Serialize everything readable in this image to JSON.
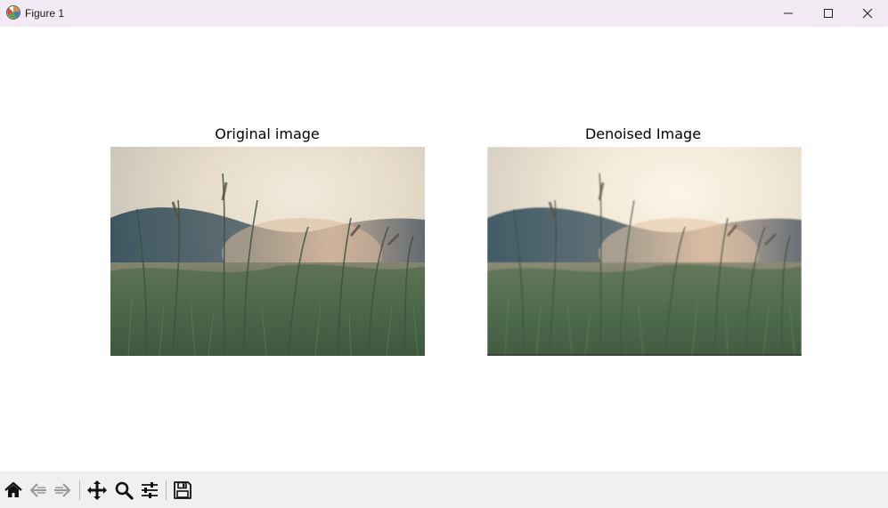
{
  "window": {
    "title": "Figure 1",
    "app_icon": "matplotlib-figure-icon",
    "controls": [
      "minimize-icon",
      "maximize-icon",
      "close-icon"
    ]
  },
  "figure": {
    "background": "#ffffff",
    "subplots": [
      {
        "title": "Original image",
        "content": "grass-meadow-photo",
        "noise": "grainy"
      },
      {
        "title": "Denoised Image",
        "content": "grass-meadow-photo",
        "noise": "smoothed"
      }
    ]
  },
  "toolbar": {
    "tools": [
      {
        "name": "home-icon",
        "tooltip": "Reset original view"
      },
      {
        "name": "back-arrow-icon",
        "tooltip": "Back to previous view"
      },
      {
        "name": "forward-arrow-icon",
        "tooltip": "Forward to next view"
      },
      {
        "name": "pan-move-icon",
        "tooltip": "Pan axes"
      },
      {
        "name": "zoom-magnifier-icon",
        "tooltip": "Zoom to rectangle"
      },
      {
        "name": "configure-subplots-icon",
        "tooltip": "Configure subplots"
      },
      {
        "name": "save-floppy-icon",
        "tooltip": "Save the figure"
      }
    ]
  },
  "colors": {
    "titlebar": "#f3ebf3",
    "toolbar": "#f0f0f0",
    "sky": "#f3ead6",
    "hill": "#3e5866",
    "grass": "#3f5a3c"
  }
}
